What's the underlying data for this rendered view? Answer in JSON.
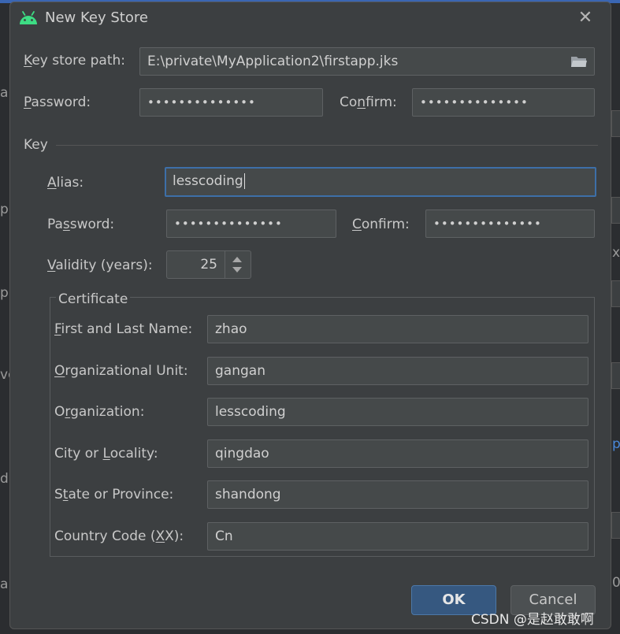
{
  "title": "New Key Store",
  "keystore": {
    "path_label": "Key store path:",
    "path_value": "E:\\private\\MyApplication2\\firstapp.jks",
    "password_label": "Password:",
    "password_mask": "••••••••••••••",
    "confirm_label": "Confirm:",
    "confirm_mask": "••••••••••••••"
  },
  "key": {
    "section_title": "Key",
    "alias_label": "Alias:",
    "alias_value": "lesscoding",
    "password_label": "Password:",
    "password_mask": "••••••••••••••",
    "confirm_label": "Confirm:",
    "confirm_mask": "••••••••••••••",
    "validity_label": "Validity (years):",
    "validity_value": "25"
  },
  "certificate": {
    "legend": "Certificate",
    "fields": [
      {
        "label": "First and Last Name:",
        "value": "zhao"
      },
      {
        "label": "Organizational Unit:",
        "value": "gangan"
      },
      {
        "label": "Organization:",
        "value": "lesscoding"
      },
      {
        "label": "City or Locality:",
        "value": "qingdao"
      },
      {
        "label": "State or Province:",
        "value": "shandong"
      },
      {
        "label": "Country Code (XX):",
        "value": "Cn"
      }
    ]
  },
  "buttons": {
    "ok": "OK",
    "cancel": "Cancel"
  },
  "watermark": "CSDN @是赵敢敢啊",
  "background_fragments": {
    "f1": "a",
    "f2": "p",
    "f3": "p",
    "f4": "vc",
    "f5": "d",
    "f6": "x",
    "f7": "p",
    "f8": "0",
    "f9": "a"
  },
  "colors": {
    "dialog_bg": "#3c3f41",
    "field_bg": "#45494a",
    "focus_border": "#3d6fa8",
    "ok_button": "#365880",
    "android_green": "#3ddc84"
  },
  "icons": {
    "app": "android-icon",
    "close": "close-icon",
    "browse": "folder-icon",
    "spinner": "spinner-arrows-icon"
  }
}
